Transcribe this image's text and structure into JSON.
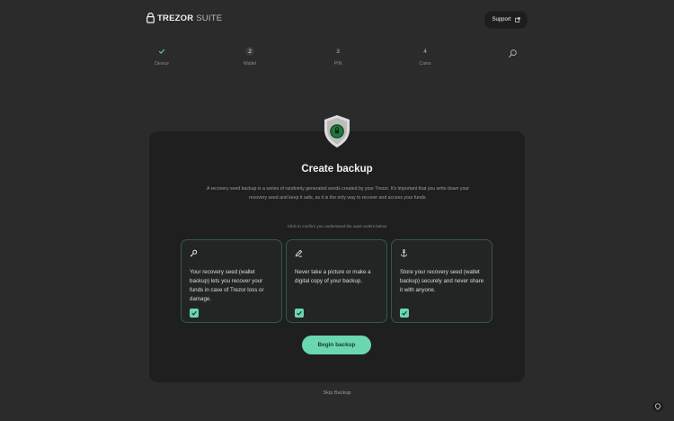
{
  "header": {
    "logo_strong": "TREZOR",
    "logo_light": "SUITE",
    "support_label": "Support",
    "support_icon": "external-link-icon"
  },
  "stepper": {
    "steps": [
      {
        "number": "✓",
        "label": "Device",
        "state": "done"
      },
      {
        "number": "2",
        "label": "Wallet",
        "state": "current"
      },
      {
        "number": "3",
        "label": "PIN",
        "state": "pending"
      },
      {
        "number": "4",
        "label": "Coins",
        "state": "pending"
      }
    ],
    "final_icon": "magnifier-icon"
  },
  "card": {
    "icon": "shield-icon",
    "title": "Create backup",
    "description": "A recovery seed backup is a series of randomly generated words created by your Trezor. It's important that you write down your recovery seed and keep it safe, as it is the only way to recover and access your funds.",
    "hint": "Click to confirm you understand the want orders below",
    "tiles": [
      {
        "icon": "key-icon",
        "text": "Your recovery seed (wallet backup) lets you recover your funds in case of Trezor loss or damage.",
        "checked": true
      },
      {
        "icon": "pencil-icon",
        "text": "Never take a picture or make a digital copy of your backup.",
        "checked": true
      },
      {
        "icon": "anchor-icon",
        "text": "Store your recovery seed (wallet backup) securely and never share it with anyone.",
        "checked": true
      }
    ],
    "cta_label": "Begin backup"
  },
  "footer": {
    "skip_label": "Skip Backup",
    "corner_icon": "guide-icon"
  },
  "colors": {
    "background": "#2b2b2b",
    "card": "#1f1f1f",
    "accent": "#6ad7b1",
    "tile_border": "#2f5a4b"
  }
}
